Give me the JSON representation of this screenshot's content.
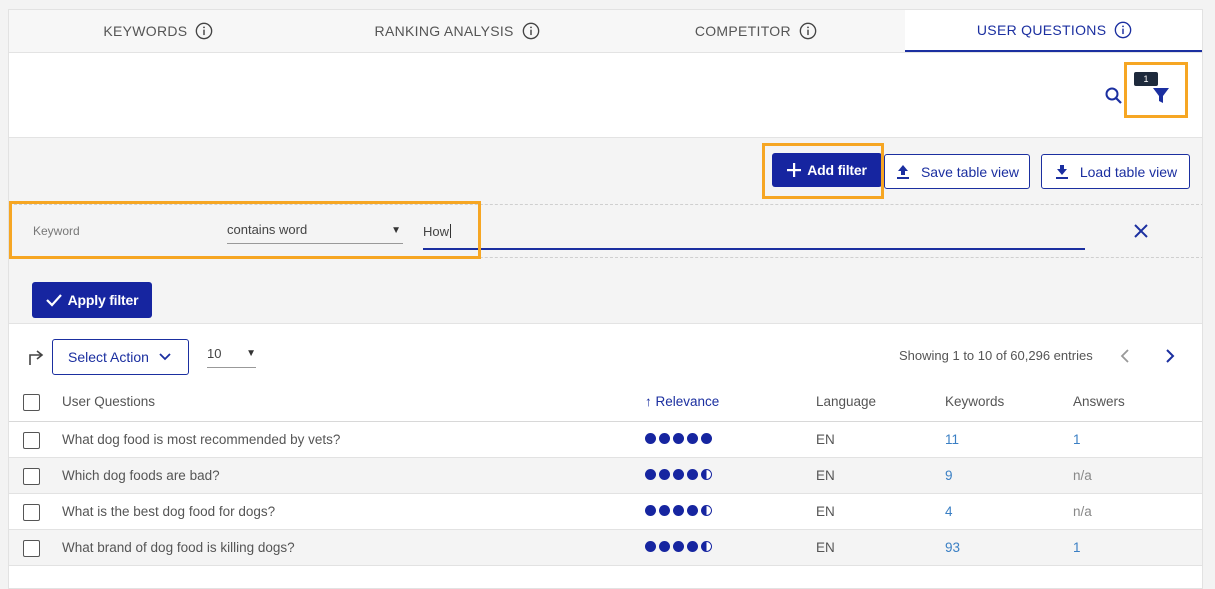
{
  "tabs": [
    {
      "label": "KEYWORDS"
    },
    {
      "label": "RANKING ANALYSIS"
    },
    {
      "label": "COMPETITOR"
    },
    {
      "label": "USER QUESTIONS"
    }
  ],
  "toolbar": {
    "filter_badge": "1"
  },
  "filter_bar": {
    "add_filter_label": "Add filter",
    "save_view_label": "Save table view",
    "load_view_label": "Load table view",
    "apply_label": "Apply filter"
  },
  "filter": {
    "field_label": "Keyword",
    "operator": "contains word",
    "value": "How"
  },
  "controls": {
    "select_action_label": "Select Action",
    "page_size": "10",
    "showing_text": "Showing 1 to 10 of 60,296 entries"
  },
  "table": {
    "headers": {
      "question": "User Questions",
      "relevance": "Relevance",
      "language": "Language",
      "keywords": "Keywords",
      "answers": "Answers"
    },
    "rows": [
      {
        "question": "What dog food is most recommended by vets?",
        "relevance": 5,
        "language": "EN",
        "keywords": "11",
        "answers": "1"
      },
      {
        "question": "Which dog foods are bad?",
        "relevance": 4.5,
        "language": "EN",
        "keywords": "9",
        "answers": "n/a"
      },
      {
        "question": "What is the best dog food for dogs?",
        "relevance": 4.5,
        "language": "EN",
        "keywords": "4",
        "answers": "n/a"
      },
      {
        "question": "What brand of dog food is killing dogs?",
        "relevance": 4.5,
        "language": "EN",
        "keywords": "93",
        "answers": "1"
      }
    ]
  },
  "colors": {
    "primary": "#1625a0",
    "highlight": "#f6a623",
    "link": "#3a7fc4"
  }
}
